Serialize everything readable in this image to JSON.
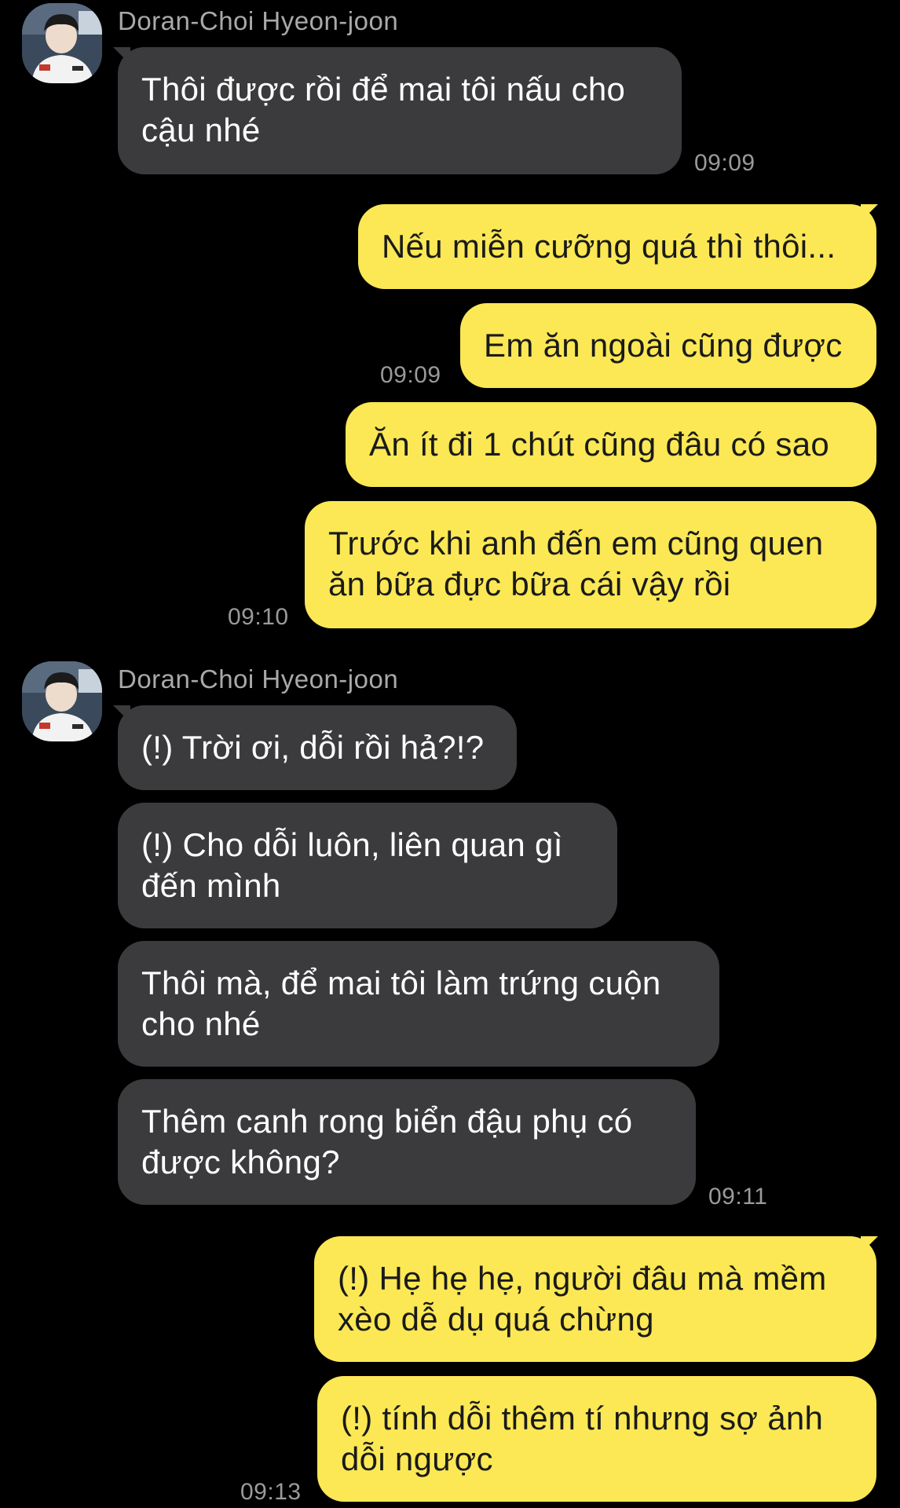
{
  "chat": {
    "messages": [
      {
        "type": "sender",
        "name": "Doran-Choi Hyeon-joon"
      },
      {
        "type": "in",
        "text": "Thôi được rồi để mai tôi nấu cho cậu nhé",
        "time": "09:09"
      },
      {
        "type": "out",
        "text": "Nếu miễn cưỡng quá thì thôi..."
      },
      {
        "type": "out",
        "text": "Em ăn ngoài cũng được",
        "time": "09:09"
      },
      {
        "type": "out",
        "text": "Ăn ít đi 1 chút cũng đâu có sao"
      },
      {
        "type": "out",
        "text": "Trước khi anh đến em cũng quen ăn bữa đực bữa cái vậy rồi",
        "time": "09:10"
      },
      {
        "type": "sender",
        "name": "Doran-Choi Hyeon-joon"
      },
      {
        "type": "in",
        "text": "(!) Trời ơi, dỗi rồi hả?!?"
      },
      {
        "type": "in",
        "text": "(!) Cho dỗi luôn, liên quan gì đến mình"
      },
      {
        "type": "in",
        "text": "Thôi mà, để mai tôi làm trứng cuộn cho nhé"
      },
      {
        "type": "in",
        "text": "Thêm canh rong biển đậu phụ có được không?",
        "time": "09:11"
      },
      {
        "type": "out",
        "text": "(!) Hẹ hẹ hẹ, người đâu mà mềm xèo dễ dụ quá chừng"
      },
      {
        "type": "out",
        "text": "(!) tính dỗi thêm tí nhưng sợ ảnh dỗi ngược",
        "time": "09:13"
      }
    ]
  },
  "colors": {
    "background": "#000000",
    "incoming_bubble": "#3b3b3d",
    "outgoing_bubble": "#fbe854",
    "timestamp": "#9a9a9a"
  }
}
